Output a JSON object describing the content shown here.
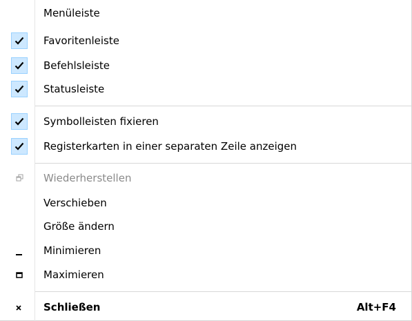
{
  "menu": {
    "items": [
      {
        "label": "Menüleiste",
        "checked": false
      },
      {
        "label": "Favoritenleiste",
        "checked": true
      },
      {
        "label": "Befehlsleiste",
        "checked": true
      },
      {
        "label": "Statusleiste",
        "checked": true
      },
      {
        "label": "Symbolleisten fixieren",
        "checked": true
      },
      {
        "label": "Registerkarten in einer separaten Zeile anzeigen",
        "checked": true
      },
      {
        "label": "Wiederherstellen",
        "icon": "restore-icon",
        "disabled": true
      },
      {
        "label": "Verschieben"
      },
      {
        "label": "Größe ändern"
      },
      {
        "label": "Minimieren",
        "icon": "minimize-icon"
      },
      {
        "label": "Maximieren",
        "icon": "maximize-icon"
      },
      {
        "label": "Schließen",
        "icon": "close-icon",
        "shortcut": "Alt+F4",
        "bold": true
      }
    ]
  },
  "colors": {
    "check_background": "#cde8ff",
    "check_border": "#99d1ff",
    "disabled_text": "#8a8a8a"
  }
}
